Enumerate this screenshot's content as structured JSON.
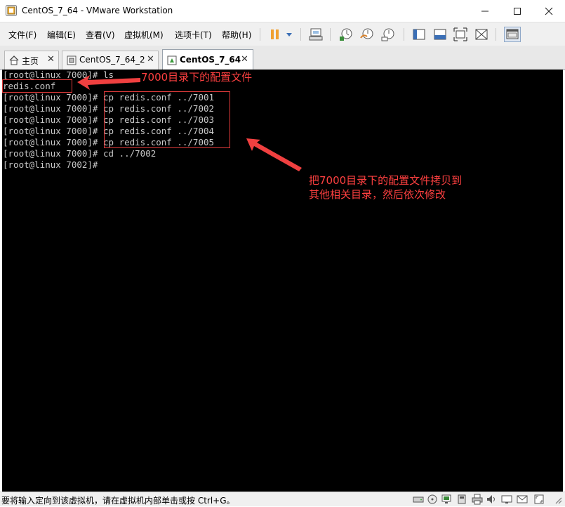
{
  "window": {
    "title": "CentOS_7_64 - VMware Workstation",
    "controls": {
      "minimize": "—",
      "maximize": "☐",
      "close": "✕"
    }
  },
  "menu": {
    "items": [
      "文件(F)",
      "编辑(E)",
      "查看(V)",
      "虚拟机(M)",
      "选项卡(T)",
      "帮助(H)"
    ]
  },
  "toolbar": {
    "icons": [
      "pause-icon",
      "dropdown-icon",
      "send-ctrl-alt-del-icon",
      "snapshot-icon",
      "revert-snapshot-icon",
      "snapshot-manager-icon",
      "sidebar-icon",
      "console-view-icon",
      "fullscreen-icon",
      "unity-icon",
      "thumbnail-icon"
    ]
  },
  "tabs": [
    {
      "label": "主页",
      "close": "✕",
      "icon": "home-icon",
      "active": false
    },
    {
      "label": "CentOS_7_64_2",
      "close": "✕",
      "icon": "vm-icon",
      "active": false
    },
    {
      "label": "CentOS_7_64",
      "close": "✕",
      "icon": "vm-icon",
      "active": true
    }
  ],
  "terminal": {
    "lines": [
      "[root@linux 7000]# ls",
      "redis.conf",
      "[root@linux 7000]# cp redis.conf ../7001",
      "[root@linux 7000]# cp redis.conf ../7002",
      "[root@linux 7000]# cp redis.conf ../7003",
      "[root@linux 7000]# cp redis.conf ../7004",
      "[root@linux 7000]# cp redis.conf ../7005",
      "[root@linux 7000]# cd ../7002",
      "[root@linux 7002]#"
    ]
  },
  "annotations": {
    "note1": "7000目录下的配置文件",
    "note2_line1": "把7000目录下的配置文件拷贝到",
    "note2_line2": "其他相关目录，然后依次修改",
    "color": "#ff4040"
  },
  "status": {
    "text": "要将输入定向到该虚拟机，请在虚拟机内部单击或按 Ctrl+G。",
    "icons": [
      "hard-disk-icon",
      "cd-icon",
      "network-icon",
      "usb-icon",
      "printer-icon",
      "sound-icon",
      "display-icon",
      "message-icon",
      "fullscreen-small-icon",
      "resize-grip-icon"
    ]
  }
}
